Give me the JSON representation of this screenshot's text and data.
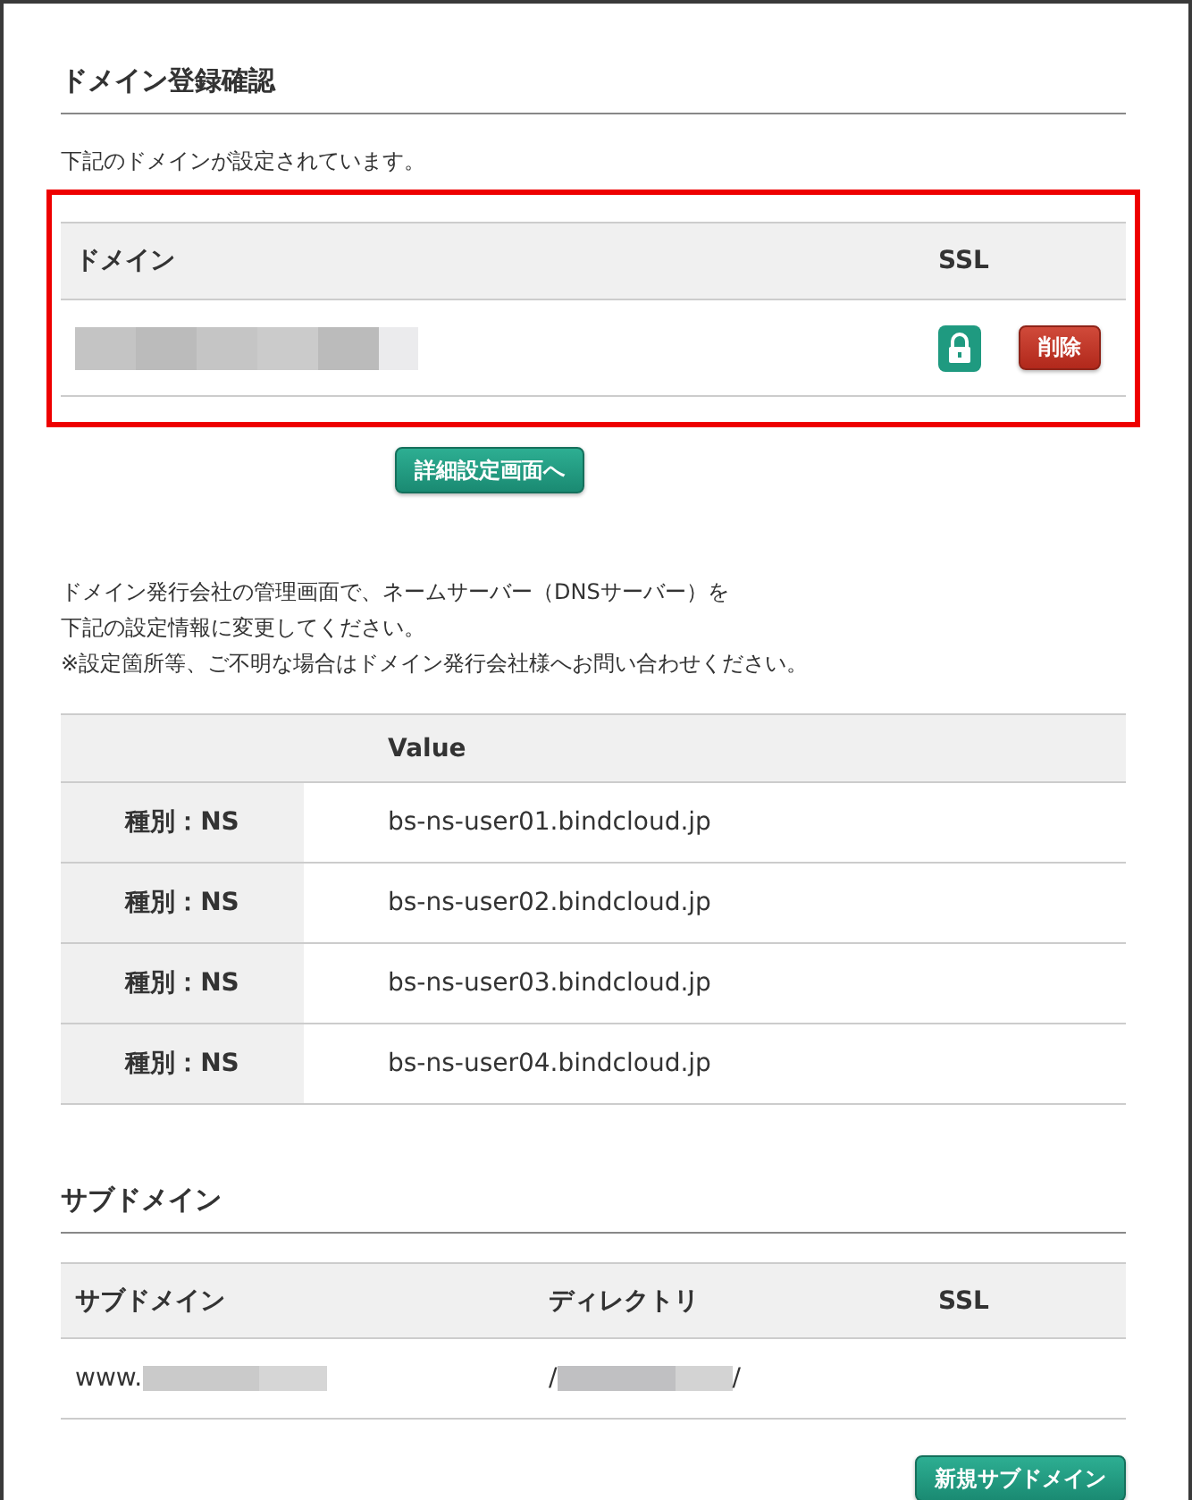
{
  "domain_section": {
    "title": "ドメイン登録確認",
    "intro": "下記のドメインが設定されています。",
    "highlighted": true,
    "table": {
      "columns": [
        "ドメイン",
        "SSL"
      ],
      "rows": [
        {
          "domain_masked": true,
          "ssl_enabled": true,
          "delete_label": "削除"
        }
      ]
    },
    "detail_button": "詳細設定画面へ"
  },
  "ns_section": {
    "instructions": [
      "ドメイン発行会社の管理画面で、ネームサーバー（DNSサーバー）を",
      "下記の設定情報に変更してください。",
      "※設定箇所等、ご不明な場合はドメイン発行会社様へお問い合わせください。"
    ],
    "table": {
      "columns": [
        "Value"
      ],
      "rows": [
        {
          "type": "種別：NS",
          "value": "bs-ns-user01.bindcloud.jp"
        },
        {
          "type": "種別：NS",
          "value": "bs-ns-user02.bindcloud.jp"
        },
        {
          "type": "種別：NS",
          "value": "bs-ns-user03.bindcloud.jp"
        },
        {
          "type": "種別：NS",
          "value": "bs-ns-user04.bindcloud.jp"
        }
      ]
    }
  },
  "subdomain_section": {
    "title": "サブドメイン",
    "table": {
      "columns": [
        "サブドメイン",
        "ディレクトリ",
        "SSL"
      ],
      "rows": [
        {
          "subdomain": "www.",
          "directory": "/",
          "directory_end": "/",
          "masked": true
        }
      ]
    },
    "new_button": "新規サブドメイン"
  }
}
